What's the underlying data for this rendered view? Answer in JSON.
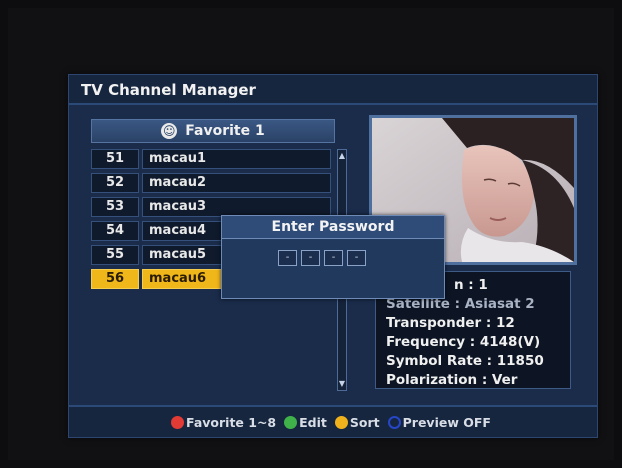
{
  "window": {
    "title": "TV Channel Manager"
  },
  "group": {
    "name": "Favorite 1",
    "icon": "smiley-icon",
    "glyph": "☺"
  },
  "channels": [
    {
      "number": "51",
      "name": "macau1",
      "selected": false
    },
    {
      "number": "52",
      "name": "macau2",
      "selected": false
    },
    {
      "number": "53",
      "name": "macau3",
      "selected": false
    },
    {
      "number": "54",
      "name": "macau4",
      "selected": false
    },
    {
      "number": "55",
      "name": "macau5",
      "selected": false
    },
    {
      "number": "56",
      "name": "macau6",
      "selected": true
    }
  ],
  "scroll": {
    "up_glyph": "▲",
    "down_glyph": "▼"
  },
  "info": {
    "partial_line": "n : 1",
    "satellite": "Satellite : Asiasat 2",
    "transponder": "Transponder : 12",
    "frequency": "Frequency : 4148(V)",
    "symbol_rate": "Symbol Rate : 11850",
    "polarization": "Polarization : Ver"
  },
  "dialog": {
    "title": "Enter Password",
    "fields": [
      "-",
      "-",
      "-",
      "-"
    ]
  },
  "footer": {
    "items": [
      {
        "label": "Favorite 1~8",
        "color": "#e23a35",
        "icon": "red-dot-icon"
      },
      {
        "label": "Edit",
        "color": "#3fb24a",
        "icon": "green-dot-icon"
      },
      {
        "label": "Sort",
        "color": "#f0b21c",
        "icon": "yellow-dot-icon"
      },
      {
        "label": "Preview OFF",
        "color": "#2646c8",
        "icon": "blue-dot-icon"
      }
    ]
  },
  "colors": {
    "panel": "#1a2c4a",
    "highlight": "#f0b71a"
  }
}
